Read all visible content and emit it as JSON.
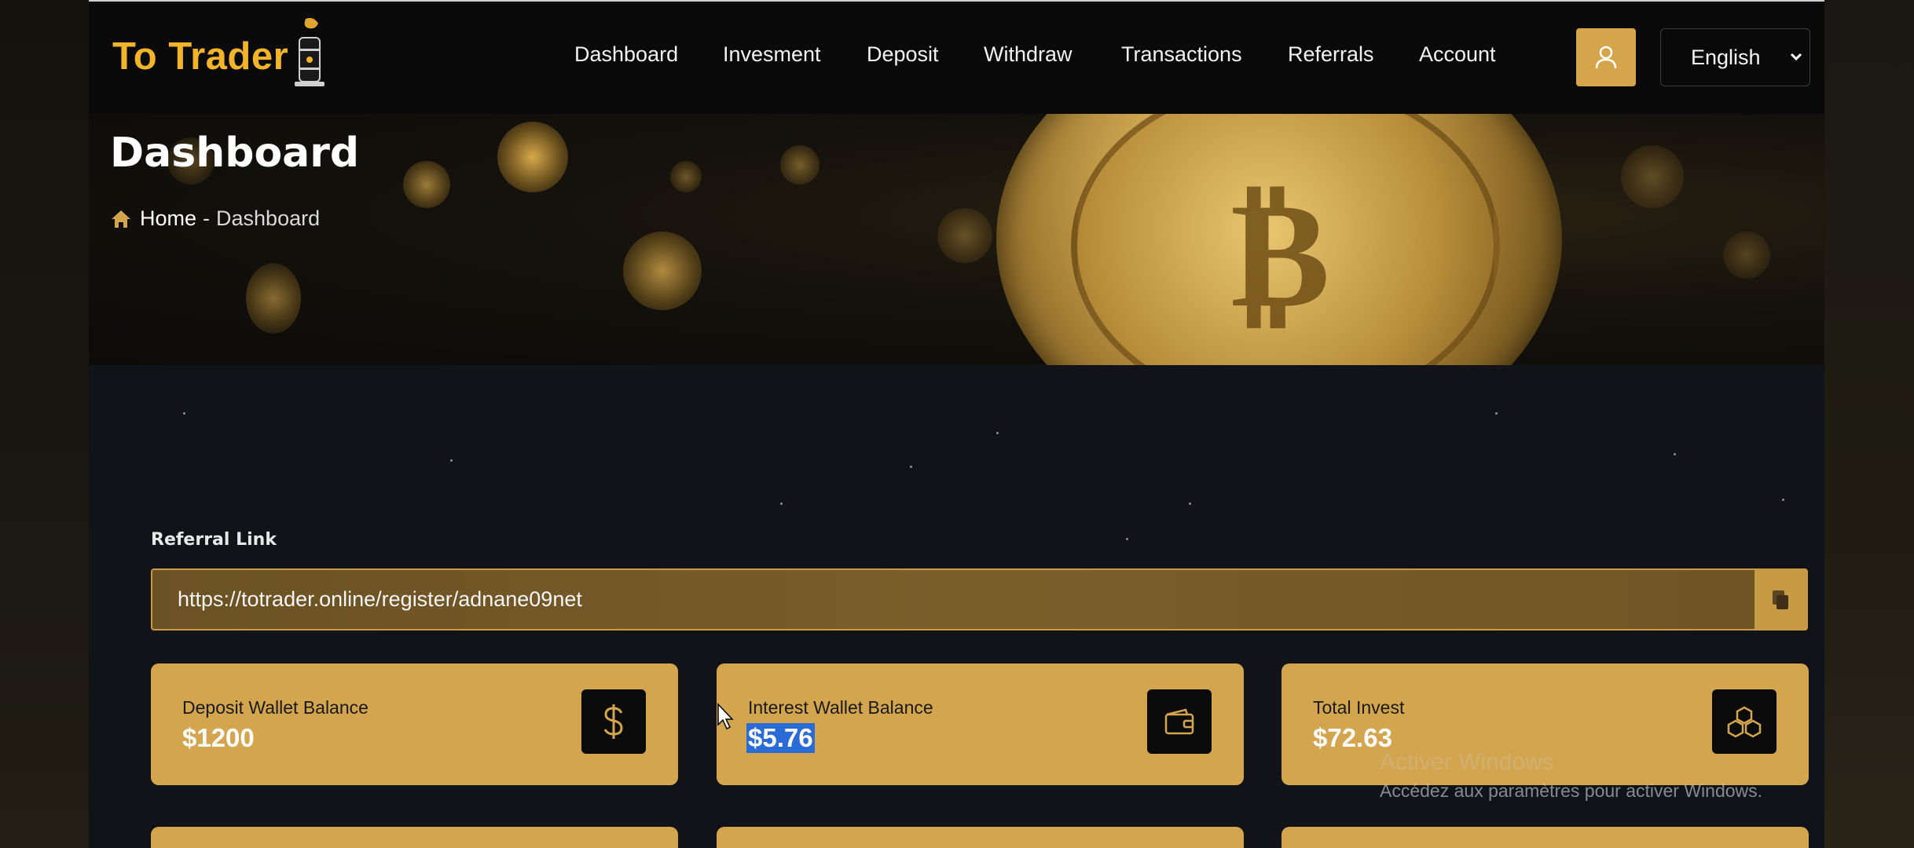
{
  "header": {
    "logo_text": "To Trader",
    "nav": [
      "Dashboard",
      "Invesment",
      "Deposit",
      "Withdraw",
      "Transactions",
      "Referrals",
      "Account"
    ],
    "language": "English",
    "icons": {
      "user": "user-icon",
      "caret": "chevron-down-icon"
    }
  },
  "hero": {
    "title": "Dashboard",
    "breadcrumb": {
      "home": "Home",
      "separator": "-",
      "current": "Dashboard"
    }
  },
  "referral": {
    "label": "Referral Link",
    "value": "https://totrader.online/register/adnane09net"
  },
  "cards": [
    {
      "label": "Deposit Wallet Balance",
      "value": "$1200",
      "icon": "dollar-icon"
    },
    {
      "label": "Interest Wallet Balance",
      "value": "$5.76",
      "icon": "wallet-icon"
    },
    {
      "label": "Total Invest",
      "value": "$72.63",
      "icon": "cubes-icon"
    }
  ],
  "watermark": {
    "title": "Activer Windows",
    "subtitle": "Accédez aux paramètres pour activer Windows."
  },
  "colors": {
    "accent": "#d4a54f",
    "logo": "#f2b429",
    "selection": "#2b6bd6"
  }
}
